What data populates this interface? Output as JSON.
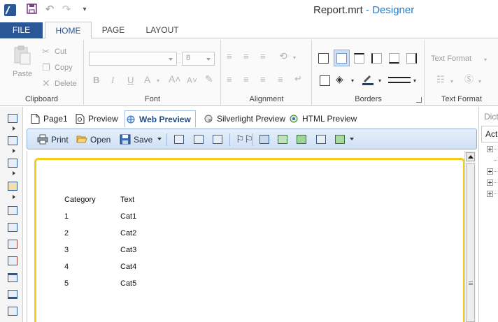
{
  "titlebar": {
    "doc_name": "Report.mrt",
    "separator": " - ",
    "app_name": "Designer"
  },
  "ribbon_tabs": {
    "file": "FILE",
    "home": "HOME",
    "page": "PAGE",
    "layout": "LAYOUT",
    "active": "HOME"
  },
  "clipboard": {
    "label": "Clipboard",
    "paste": "Paste",
    "cut": "Cut",
    "copy": "Copy",
    "delete": "Delete"
  },
  "font": {
    "label": "Font",
    "size_value": "8"
  },
  "alignment": {
    "label": "Alignment"
  },
  "borders": {
    "label": "Borders"
  },
  "text_format": {
    "label": "Text Format",
    "combo_value": "Text Format"
  },
  "doc_tabs": {
    "page1": "Page1",
    "preview": "Preview",
    "web_preview": "Web Preview",
    "silverlight_preview": "Silverlight Preview",
    "html_preview": "HTML Preview",
    "active": "Web Preview"
  },
  "preview_toolbar": {
    "print": "Print",
    "open": "Open",
    "save": "Save"
  },
  "report_table": {
    "headers": [
      "Category",
      "Text"
    ],
    "rows": [
      [
        "1",
        "Cat1"
      ],
      [
        "2",
        "Cat2"
      ],
      [
        "3",
        "Cat3"
      ],
      [
        "4",
        "Cat4"
      ],
      [
        "5",
        "Cat5"
      ]
    ]
  },
  "dictionary": {
    "title": "Dicti",
    "actions": "Act"
  },
  "colors": {
    "accent": "#2b5797",
    "title_app": "#2b78c5",
    "page_border": "#f4cd1c"
  }
}
